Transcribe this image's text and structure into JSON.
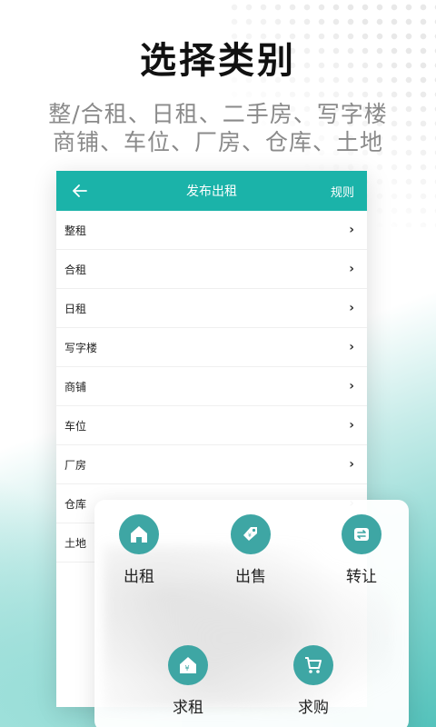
{
  "headline": "选择类别",
  "subline": [
    "整/合租、日租、二手房、写字楼",
    "商铺、车位、厂房、仓库、土地"
  ],
  "appbar": {
    "back_icon": "arrow-left-icon",
    "title": "发布出租",
    "rules_label": "规则"
  },
  "categories": [
    {
      "label": "整租"
    },
    {
      "label": "合租"
    },
    {
      "label": "日租"
    },
    {
      "label": "写字楼"
    },
    {
      "label": "商铺"
    },
    {
      "label": "车位"
    },
    {
      "label": "厂房"
    },
    {
      "label": "仓库"
    },
    {
      "label": "土地"
    }
  ],
  "actions": [
    {
      "label": "出租",
      "icon": "house-icon"
    },
    {
      "label": "出售",
      "icon": "price-tag-icon"
    },
    {
      "label": "转让",
      "icon": "swap-arrows-icon"
    },
    {
      "label": "求租",
      "icon": "house-yen-icon"
    },
    {
      "label": "求购",
      "icon": "shopping-cart-icon"
    }
  ],
  "colors": {
    "accent": "#1bb3a9",
    "icon_circle": "#3ea6a4"
  }
}
